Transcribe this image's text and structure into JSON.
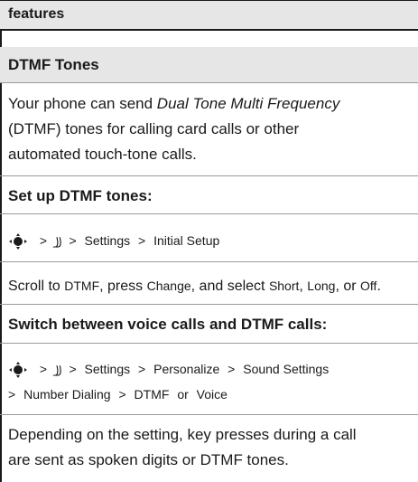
{
  "header": {
    "title": "features"
  },
  "section": {
    "title": "DTMF Tones"
  },
  "intro": {
    "pre": "Your phone can send ",
    "emphasis": "Dual Tone Multi Frequency",
    "line2": "(DTMF) tones for calling card calls or other",
    "line3": "automated touch-tone calls."
  },
  "setup": {
    "heading": "Set up DTMF tones:",
    "path": {
      "menu_glyph": "꠸꠸",
      "settings": "Settings",
      "initial_setup": "Initial Setup"
    },
    "instruction": {
      "t1": "Scroll to ",
      "dtmf": "DTMF",
      "t2": ", press ",
      "change": "Change",
      "t3": ", and select ",
      "short": "Short",
      "t4": ", ",
      "long": "Long",
      "t5": ", or ",
      "off": "Off",
      "t6": "."
    }
  },
  "switch": {
    "heading": "Switch between voice calls and DTMF calls:",
    "path": {
      "settings": "Settings",
      "personalize": "Personalize",
      "sound_settings": "Sound Settings",
      "number_dialing": "Number Dialing",
      "dtmf": "DTMF",
      "or": "or",
      "voice": "Voice"
    }
  },
  "closing": {
    "line1": "Depending on the setting, key presses during a call",
    "line2": "are sent as spoken digits or DTMF tones."
  },
  "symbols": {
    "gt": ">"
  }
}
